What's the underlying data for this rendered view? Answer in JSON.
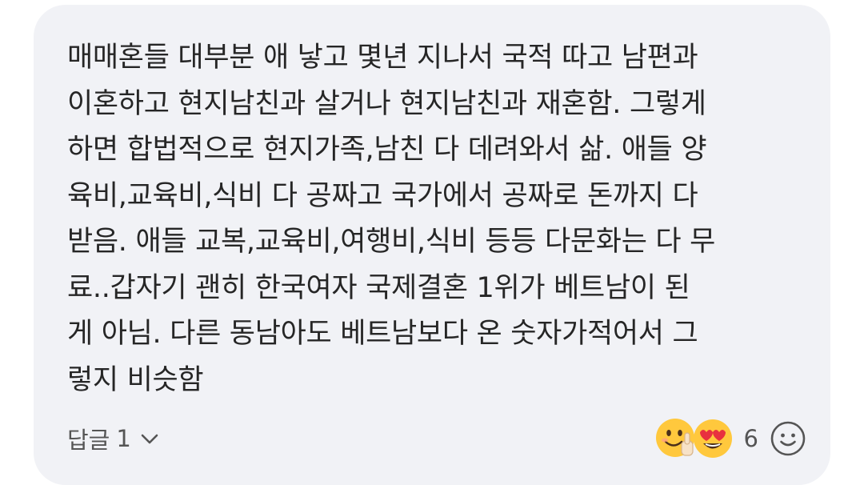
{
  "comment": {
    "lines": [
      "매매혼들 대부분 애 낳고 몇년 지나서 국적 따고 남편과",
      "이혼하고 현지남친과 살거나 현지남친과 재혼함. 그렇게",
      "하면 합법적으로 현지가족,남친 다 데려와서 삶. 애들 양",
      "육비,교육비,식비 다 공짜고 국가에서 공짜로 돈까지 다",
      "받음. 애들 교복,교육비,여행비,식비 등등 다문화는 다 무",
      "료..갑자기 괜히 한국여자 국제결혼 1위가 베트남이 된",
      "게 아님. 다른 동남아도 베트남보다 온 숫자가적어서 그",
      "렇지 비슷함"
    ]
  },
  "footer": {
    "reply_label": "답글",
    "reply_count": "1",
    "reaction_icons": [
      "thumbs-up-smiley-emoji",
      "heart-eyes-emoji"
    ],
    "reaction_count": "6",
    "add_reaction_icon": "smiley-outline-icon"
  },
  "colors": {
    "card_background": "#f1f2f6",
    "text": "#262626",
    "secondary_text": "#555555",
    "emoji_yellow": "#ffc83d",
    "heart_red": "#e8313f"
  }
}
